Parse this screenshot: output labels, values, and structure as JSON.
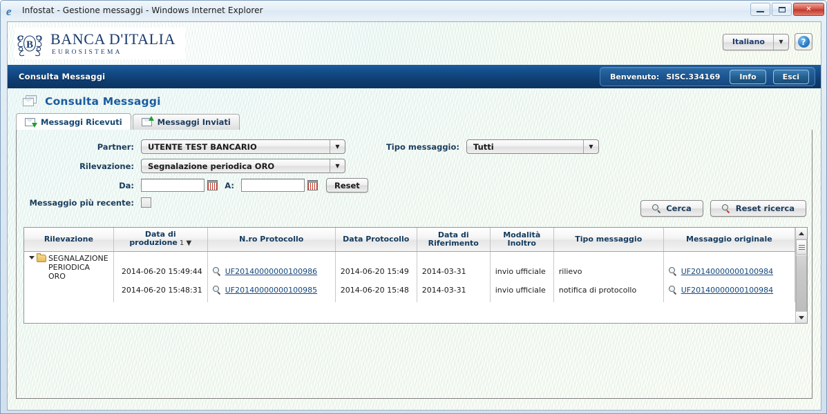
{
  "window": {
    "title": "Infostat - Gestione messaggi - Windows Internet Explorer",
    "app_icon": "internet-explorer-icon",
    "minimize_label": "",
    "maximize_label": "",
    "close_label": "✕"
  },
  "brand": {
    "name": "BANCA D'ITALIA",
    "subtitle": "EUROSISTEMA",
    "logo_icon": "banca-ditalia-crest-icon"
  },
  "header": {
    "language": "Italiano",
    "language_caret": "▼",
    "help_glyph": "?"
  },
  "navbar": {
    "title": "Consulta Messaggi",
    "welcome_label": "Benvenuto:",
    "username": "SISC.334169",
    "info_button": "Info",
    "exit_button": "Esci"
  },
  "page": {
    "title": "Consulta Messaggi",
    "title_icon": "messages-icon"
  },
  "tabs": [
    {
      "label": "Messaggi Ricevuti",
      "icon": "inbox-envelope-icon",
      "active": true
    },
    {
      "label": "Messaggi Inviati",
      "icon": "outbox-envelope-icon",
      "active": false
    }
  ],
  "form": {
    "partner_label": "Partner:",
    "partner_value": "UTENTE TEST BANCARIO",
    "rilevazione_label": "Rilevazione:",
    "rilevazione_value": "Segnalazione periodica ORO",
    "tipo_messaggio_label": "Tipo messaggio:",
    "tipo_messaggio_value": "Tutti",
    "da_label": "Da:",
    "da_value": "",
    "a_label": "A:",
    "a_value": "",
    "reset_button": "Reset",
    "recente_label": "Messaggio più recente:",
    "recente_checked": false,
    "caret": "▼",
    "calendar_icon": "calendar-icon"
  },
  "actions": {
    "search_button": "Cerca",
    "search_icon": "magnifier-icon",
    "reset_search_button": "Reset ricerca",
    "reset_search_icon": "magnifier-minus-icon"
  },
  "table": {
    "columns": [
      {
        "label": "Rilevazione",
        "sort": ""
      },
      {
        "label": "Data di produzione",
        "sort": "1 ▼"
      },
      {
        "label": "N.ro Protocollo",
        "sort": ""
      },
      {
        "label": "Data Protocollo",
        "sort": ""
      },
      {
        "label": "Data di Riferimento",
        "sort": ""
      },
      {
        "label": "Modalità Inoltro",
        "sort": ""
      },
      {
        "label": "Tipo messaggio",
        "sort": ""
      },
      {
        "label": "Messaggio originale",
        "sort": ""
      }
    ],
    "group": {
      "label": "SEGNALAZIONE PERIODICA ORO",
      "expanded": true,
      "expander_glyph": "▼",
      "folder_icon": "folder-open-icon"
    },
    "rows": [
      {
        "data_produzione": "2014-06-20 15:49:44",
        "protocollo": "UF20140000000100986",
        "data_protocollo": "2014-06-20 15:49",
        "data_riferimento": "2014-03-31",
        "modalita_inoltro": "invio ufficiale",
        "tipo_messaggio": "rilievo",
        "messaggio_originale": "UF20140000000100984"
      },
      {
        "data_produzione": "2014-06-20 15:48:31",
        "protocollo": "UF20140000000100985",
        "data_protocollo": "2014-06-20 15:48",
        "data_riferimento": "2014-03-31",
        "modalita_inoltro": "invio ufficiale",
        "tipo_messaggio": "notifica di protocollo",
        "messaggio_originale": "UF20140000000100984"
      }
    ],
    "scrollbar": {
      "up_arrow": "▲",
      "down_arrow": "▼"
    }
  },
  "colors": {
    "brand_blue": "#1b3c6e",
    "nav_blue": "#134a85",
    "link_blue": "#14467a",
    "header_text": "#123a5e",
    "accent_green": "#1f9e2e",
    "close_red": "#c0392b"
  }
}
